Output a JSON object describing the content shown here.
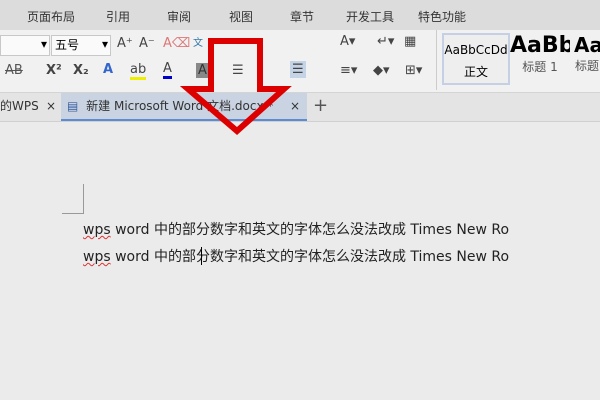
{
  "menu": [
    "页面布局",
    "引用",
    "审阅",
    "视图",
    "章节",
    "开发工具",
    "特色功能"
  ],
  "ribbon": {
    "font_size": "五号",
    "styles": [
      {
        "preview": "AaBbCcDd",
        "name": "正文"
      },
      {
        "preview": "AaBb",
        "name": "标题 1"
      },
      {
        "preview": "Aa",
        "name": "标题"
      }
    ]
  },
  "tabs": [
    {
      "label": "的WPS"
    },
    {
      "label": "新建 Microsoft Word 文档.docx *"
    }
  ],
  "document": {
    "lines": [
      {
        "sq": "wps",
        "rest": " word  中的部分数字和英文的字体怎么没法改成 Times New Ro"
      },
      {
        "sq": "wps",
        "rest": " word  中的部分数字和英文的字体怎么没法改成 Times New Ro"
      }
    ]
  },
  "accent": "#dd0000"
}
